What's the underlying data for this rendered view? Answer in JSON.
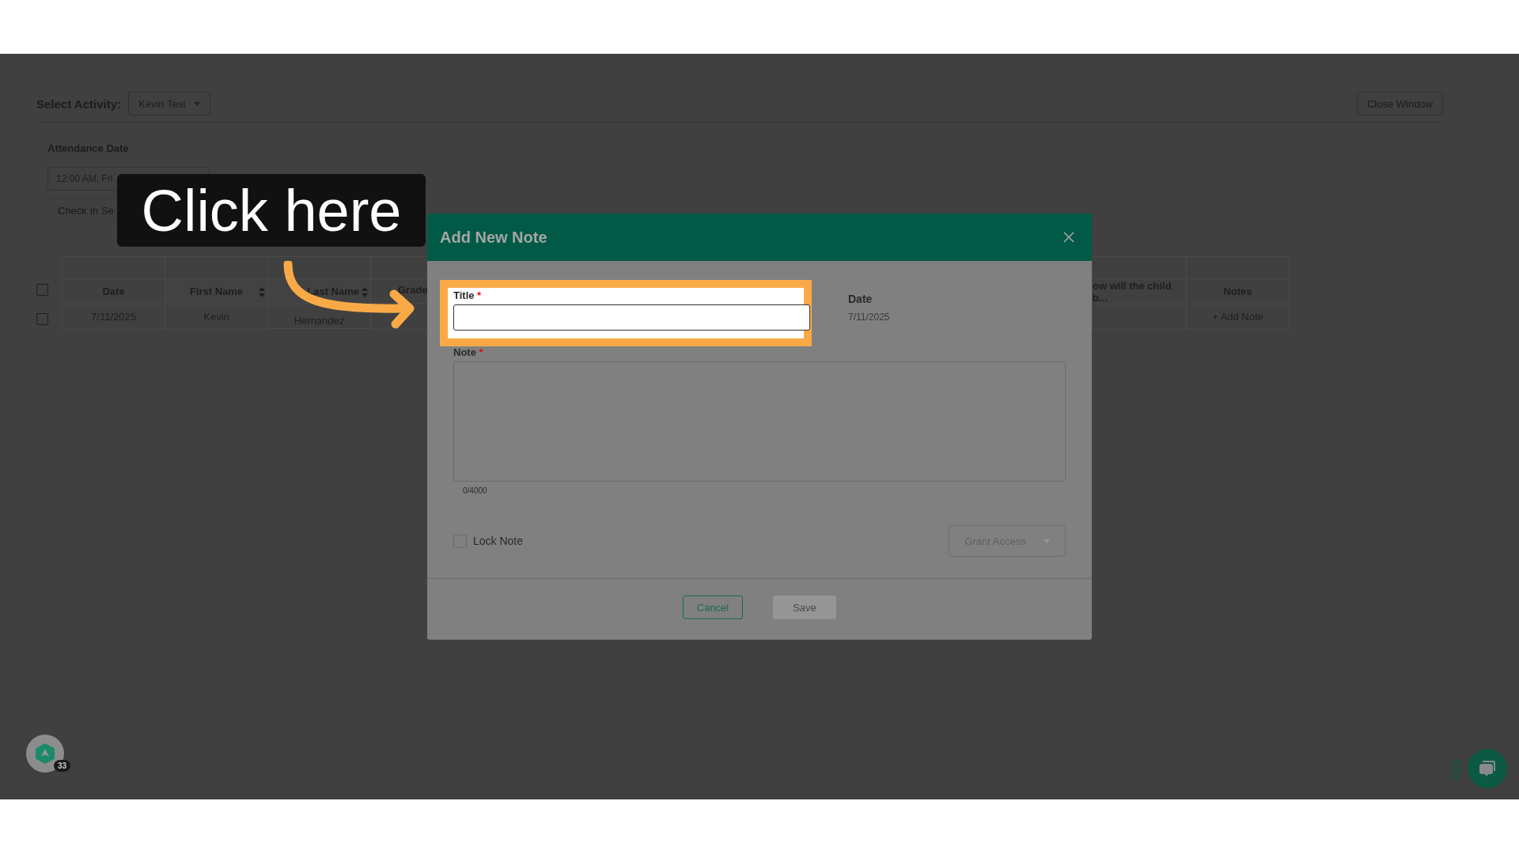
{
  "top_bar": {
    "label": "Select Activity:",
    "activity_dropdown": "Kevin Test",
    "close_button": "Close Window"
  },
  "attendance": {
    "label": "Attendance Date",
    "date_dropdown": "12:00 AM, Fri",
    "check_in_button": "Check In Se"
  },
  "table": {
    "header_checked": false,
    "columns": [
      {
        "label": "Date",
        "sortable": false
      },
      {
        "label": "First Name",
        "sortable": true
      },
      {
        "label": "Last Name",
        "sortable": true
      },
      {
        "label": "Grade"
      },
      {
        "label": "ow will the child b...",
        "sortable": false
      },
      {
        "label": "Notes",
        "sortable": false
      }
    ],
    "rows": [
      {
        "checked": false,
        "date": "7/11/2025",
        "first_name": "Kevin",
        "last_name": "Hernandez",
        "notes_link": "+ Add Note"
      }
    ]
  },
  "modal": {
    "title": "Add New Note",
    "title_label": "Title",
    "required_mark": "*",
    "date_label": "Date",
    "date_value": "7/11/2025",
    "note_label": "Note",
    "note_counter": "0/4000",
    "lock_note": {
      "label": "Lock Note",
      "checked": false
    },
    "grant_access": "Grant Access",
    "cancel": "Cancel",
    "save": {
      "label": "Save",
      "disabled": true
    }
  },
  "callout": {
    "text": "Click here"
  },
  "help_badge": {
    "count": "33"
  }
}
